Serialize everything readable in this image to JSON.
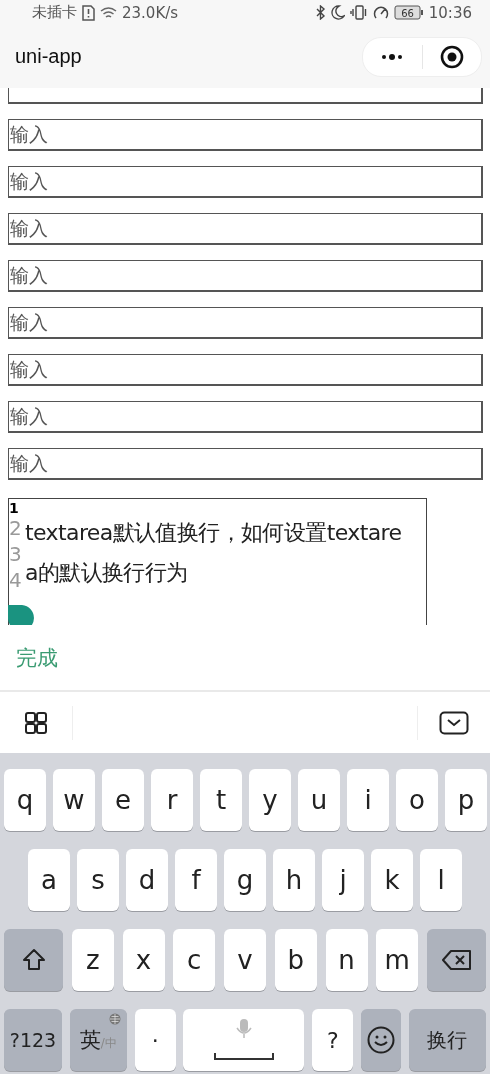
{
  "status_bar": {
    "carrier": "未插卡",
    "speed": "23.0K/s",
    "battery": "66",
    "time": "10:36"
  },
  "nav": {
    "title": "uni-app"
  },
  "inputs": [
    {
      "kind": "cut"
    },
    {
      "placeholder": "输入"
    },
    {
      "placeholder": "输入"
    },
    {
      "placeholder": "输入"
    },
    {
      "placeholder": "输入"
    },
    {
      "placeholder": "输入"
    },
    {
      "placeholder": "输入"
    },
    {
      "placeholder": "输入"
    },
    {
      "placeholder": "输入"
    }
  ],
  "textarea": {
    "line_numbers": [
      "1",
      "2",
      "3",
      "4"
    ],
    "lines": [
      "textarea默认值换行，如何设置textare",
      "a的默认换行行为"
    ]
  },
  "done_label": "完成",
  "keyboard": {
    "rows": [
      [
        {
          "kind": "letter",
          "label": "q"
        },
        {
          "kind": "letter",
          "label": "w"
        },
        {
          "kind": "letter",
          "label": "e"
        },
        {
          "kind": "letter",
          "label": "r"
        },
        {
          "kind": "letter",
          "label": "t"
        },
        {
          "kind": "letter",
          "label": "y"
        },
        {
          "kind": "letter",
          "label": "u"
        },
        {
          "kind": "letter",
          "label": "i"
        },
        {
          "kind": "letter",
          "label": "o"
        },
        {
          "kind": "letter",
          "label": "p"
        }
      ],
      [
        {
          "kind": "letter",
          "label": "a"
        },
        {
          "kind": "letter",
          "label": "s"
        },
        {
          "kind": "letter",
          "label": "d"
        },
        {
          "kind": "letter",
          "label": "f"
        },
        {
          "kind": "letter",
          "label": "g"
        },
        {
          "kind": "letter",
          "label": "h"
        },
        {
          "kind": "letter",
          "label": "j"
        },
        {
          "kind": "letter",
          "label": "k"
        },
        {
          "kind": "letter",
          "label": "l"
        }
      ],
      [
        {
          "kind": "shift"
        },
        {
          "kind": "letter",
          "label": "z"
        },
        {
          "kind": "letter",
          "label": "x"
        },
        {
          "kind": "letter",
          "label": "c"
        },
        {
          "kind": "letter",
          "label": "v"
        },
        {
          "kind": "letter",
          "label": "b"
        },
        {
          "kind": "letter",
          "label": "n"
        },
        {
          "kind": "letter",
          "label": "m"
        },
        {
          "kind": "backspace"
        }
      ],
      [
        {
          "kind": "mode",
          "label": "?123"
        },
        {
          "kind": "lang",
          "label": "英",
          "sub": "/中"
        },
        {
          "kind": "punct",
          "label": "·"
        },
        {
          "kind": "space"
        },
        {
          "kind": "punct",
          "label": "?"
        },
        {
          "kind": "emoji"
        },
        {
          "kind": "enter",
          "label": "换行"
        }
      ]
    ]
  }
}
